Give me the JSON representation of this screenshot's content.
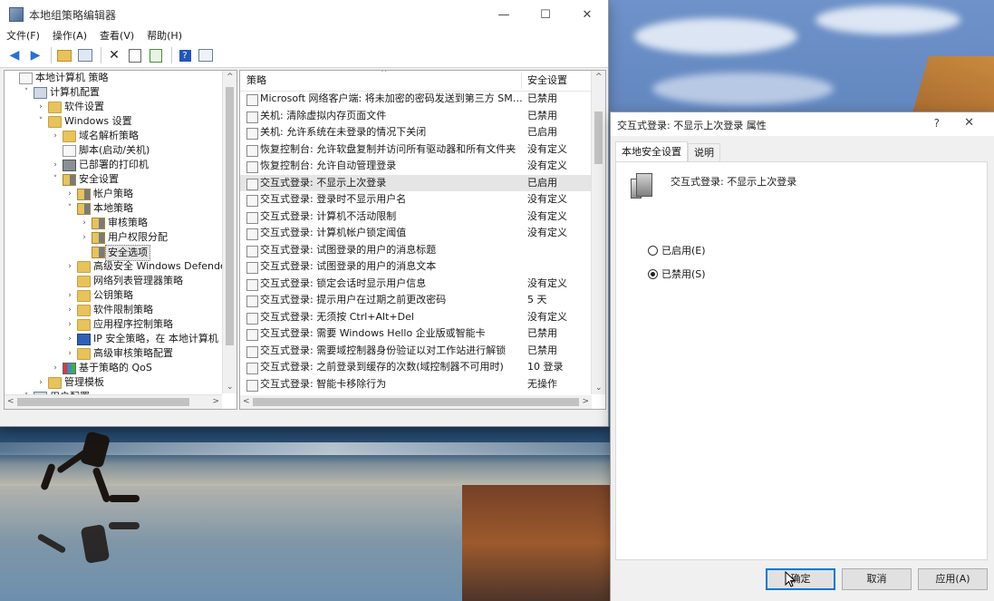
{
  "main_window": {
    "title": "本地组策略编辑器",
    "caption": {
      "minimize": "—",
      "maximize": "☐",
      "close": "✕"
    },
    "menu": [
      "文件(F)",
      "操作(A)",
      "查看(V)",
      "帮助(H)"
    ],
    "toolbar_icons": [
      "back-icon",
      "forward-icon",
      "up-folder-icon",
      "show-hide-tree-icon",
      "delete-icon",
      "properties-icon",
      "export-list-icon",
      "help-icon",
      "view-icon"
    ]
  },
  "tree": {
    "nodes": [
      {
        "label": "本地计算机 策略",
        "level": 0,
        "exp": "",
        "icon": "doc"
      },
      {
        "label": "计算机配置",
        "level": 1,
        "exp": "v",
        "icon": "pc"
      },
      {
        "label": "软件设置",
        "level": 2,
        "exp": ">",
        "icon": "folder"
      },
      {
        "label": "Windows 设置",
        "level": 2,
        "exp": "v",
        "icon": "folder"
      },
      {
        "label": "域名解析策略",
        "level": 3,
        "exp": ">",
        "icon": "folder"
      },
      {
        "label": "脚本(启动/关机)",
        "level": 3,
        "exp": "",
        "icon": "doc"
      },
      {
        "label": "已部署的打印机",
        "level": 3,
        "exp": ">",
        "icon": "printer"
      },
      {
        "label": "安全设置",
        "level": 3,
        "exp": "v",
        "icon": "shield"
      },
      {
        "label": "帐户策略",
        "level": 4,
        "exp": ">",
        "icon": "shield"
      },
      {
        "label": "本地策略",
        "level": 4,
        "exp": "v",
        "icon": "shield"
      },
      {
        "label": "审核策略",
        "level": 5,
        "exp": ">",
        "icon": "shield"
      },
      {
        "label": "用户权限分配",
        "level": 5,
        "exp": ">",
        "icon": "shield"
      },
      {
        "label": "安全选项",
        "level": 5,
        "exp": "",
        "icon": "shield",
        "selected": true
      },
      {
        "label": "高级安全 Windows Defender 防",
        "level": 4,
        "exp": ">",
        "icon": "folder"
      },
      {
        "label": "网络列表管理器策略",
        "level": 4,
        "exp": "",
        "icon": "folder"
      },
      {
        "label": "公钥策略",
        "level": 4,
        "exp": ">",
        "icon": "folder"
      },
      {
        "label": "软件限制策略",
        "level": 4,
        "exp": ">",
        "icon": "folder"
      },
      {
        "label": "应用程序控制策略",
        "level": 4,
        "exp": ">",
        "icon": "folder"
      },
      {
        "label": "IP 安全策略，在 本地计算机",
        "level": 4,
        "exp": ">",
        "icon": "net"
      },
      {
        "label": "高级审核策略配置",
        "level": 4,
        "exp": ">",
        "icon": "folder"
      },
      {
        "label": "基于策略的 QoS",
        "level": 3,
        "exp": ">",
        "icon": "chart"
      },
      {
        "label": "管理模板",
        "level": 2,
        "exp": ">",
        "icon": "folder"
      },
      {
        "label": "用户配置",
        "level": 1,
        "exp": "v",
        "icon": "pc"
      }
    ]
  },
  "list": {
    "columns": {
      "policy": "策略",
      "setting": "安全设置"
    },
    "rows": [
      {
        "policy": "Microsoft 网络客户端: 将未加密的密码发送到第三方 SMB ...",
        "setting": "已禁用"
      },
      {
        "policy": "关机: 清除虚拟内存页面文件",
        "setting": "已禁用"
      },
      {
        "policy": "关机: 允许系统在未登录的情况下关闭",
        "setting": "已启用"
      },
      {
        "policy": "恢复控制台: 允许软盘复制并访问所有驱动器和所有文件夹",
        "setting": "没有定义"
      },
      {
        "policy": "恢复控制台: 允许自动管理登录",
        "setting": "没有定义"
      },
      {
        "policy": "交互式登录: 不显示上次登录",
        "setting": "已启用",
        "highlight": true
      },
      {
        "policy": "交互式登录: 登录时不显示用户名",
        "setting": "没有定义"
      },
      {
        "policy": "交互式登录: 计算机不活动限制",
        "setting": "没有定义"
      },
      {
        "policy": "交互式登录: 计算机帐户锁定阈值",
        "setting": "没有定义"
      },
      {
        "policy": "交互式登录: 试图登录的用户的消息标题",
        "setting": ""
      },
      {
        "policy": "交互式登录: 试图登录的用户的消息文本",
        "setting": ""
      },
      {
        "policy": "交互式登录: 锁定会话时显示用户信息",
        "setting": "没有定义"
      },
      {
        "policy": "交互式登录: 提示用户在过期之前更改密码",
        "setting": "5 天"
      },
      {
        "policy": "交互式登录: 无须按 Ctrl+Alt+Del",
        "setting": "没有定义"
      },
      {
        "policy": "交互式登录: 需要 Windows Hello 企业版或智能卡",
        "setting": "已禁用"
      },
      {
        "policy": "交互式登录: 需要域控制器身份验证以对工作站进行解锁",
        "setting": "已禁用"
      },
      {
        "policy": "交互式登录: 之前登录到缓存的次数(域控制器不可用时)",
        "setting": "10 登录"
      },
      {
        "policy": "交互式登录: 智能卡移除行为",
        "setting": "无操作"
      }
    ]
  },
  "dialog": {
    "title": "交互式登录: 不显示上次登录 属性",
    "help": "?",
    "close": "✕",
    "tabs": [
      "本地安全设置",
      "说明"
    ],
    "policy_name": "交互式登录: 不显示上次登录",
    "options": [
      {
        "label": "已启用(E)",
        "checked": false
      },
      {
        "label": "已禁用(S)",
        "checked": true
      }
    ],
    "buttons": {
      "ok": "确定",
      "cancel": "取消",
      "apply": "应用(A)"
    }
  }
}
